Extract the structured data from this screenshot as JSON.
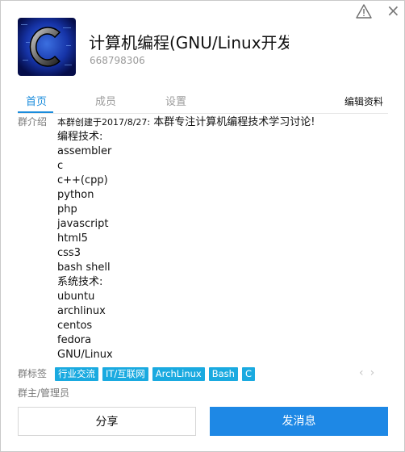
{
  "group": {
    "name": "计算机编程(GNU/Linux开发平台",
    "id": "668798306"
  },
  "tabs": {
    "home": "首页",
    "members": "成员",
    "settings": "设置",
    "edit": "编辑资料"
  },
  "sections": {
    "intro_label": "群介绍",
    "tags_label": "群标签",
    "admins_label": "群主/管理员"
  },
  "intro": {
    "created": "本群创建于2017/8/27:",
    "slogan": "本群专注计算机编程技术学习讨论!",
    "lines": [
      "编程技术:",
      "assembler",
      "c",
      "c++(cpp)",
      "python",
      "php",
      "javascript",
      "html5",
      "css3",
      "bash shell",
      "系统技术:",
      "ubuntu",
      "archlinux",
      "centos",
      "fedora",
      "GNU/Linux"
    ]
  },
  "tags": [
    "行业交流",
    "IT/互联网",
    "ArchLinux",
    "Bash",
    "C"
  ],
  "arrows": {
    "prev": "‹",
    "next": "›"
  },
  "buttons": {
    "share": "分享",
    "send": "发消息"
  },
  "icons": {
    "warning": "warning-icon",
    "close": "close-icon",
    "logo": "c-language-logo"
  },
  "colors": {
    "accent": "#1a8cdc",
    "tag": "#1aaae0",
    "send_button": "#1e88e5"
  }
}
